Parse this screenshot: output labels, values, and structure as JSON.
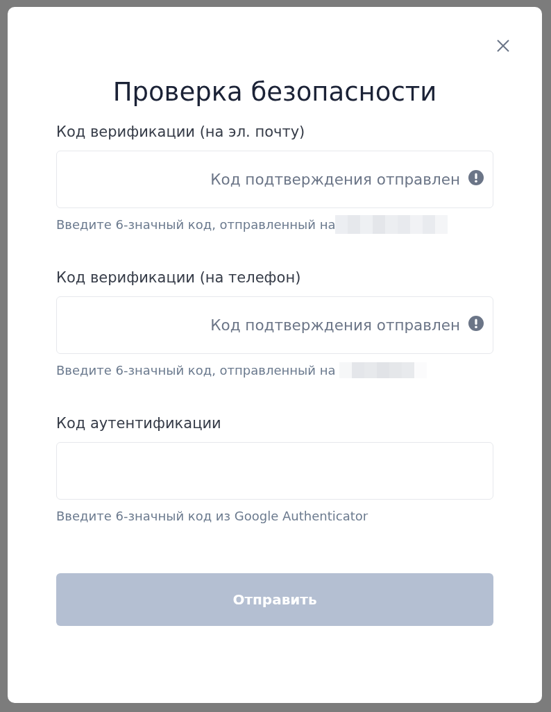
{
  "dialog": {
    "title": "Проверка безопасности"
  },
  "fields": [
    {
      "label": "Код верификации (на эл. почту)",
      "status": "Код подтверждения отправлен",
      "hint": "Введите 6-значный код, отправленный на",
      "redacted": true
    },
    {
      "label": "Код верификации (на телефон)",
      "status": "Код подтверждения отправлен",
      "hint": "Введите 6-значный код, отправленный на",
      "redacted": true
    },
    {
      "label": "Код аутентификации",
      "hint": "Введите 6-значный код из Google Authenticator",
      "redacted": false
    }
  ],
  "submit": {
    "label": "Отправить",
    "disabled": true
  }
}
